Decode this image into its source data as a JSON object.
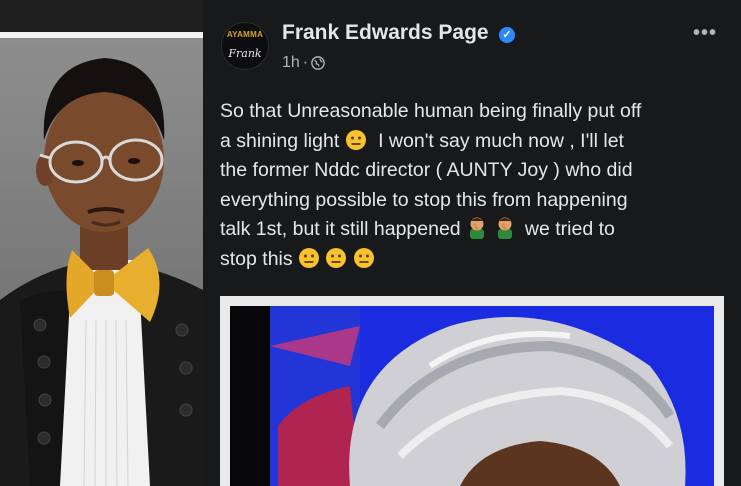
{
  "left_photo": {
    "alt": "Portrait of a young man in round glasses and a mustard bow tie"
  },
  "post": {
    "page_name": "Frank Edwards Page",
    "avatar": {
      "top_text": "AYAMMA",
      "script_text": "Frank"
    },
    "time": "1h",
    "separator": "·",
    "more_icon": "•••",
    "text_lines": [
      "So that Unreasonable human being finally put off",
      "a shining light",
      "I won't say much now , I'll let",
      "the former Nddc director ( AUNTY Joy ) who did",
      "everything possible to stop this from happening",
      "talk 1st, but it still happened",
      "we tried to",
      "stop this"
    ],
    "emojis": [
      "neutral-face",
      "facepalm",
      "neutral-face"
    ]
  },
  "colors": {
    "post_bg": "#18191a",
    "text_primary": "#e4e6eb",
    "text_secondary": "#b0b3b8",
    "verified_blue": "#2d88ff",
    "emoji_yellow": "#f7c22d",
    "attachment_blue": "#1a2be0"
  }
}
